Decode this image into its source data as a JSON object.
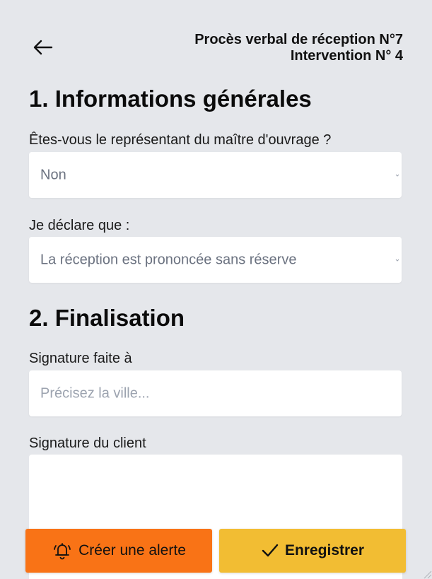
{
  "header": {
    "back_icon": "arrow-left-icon",
    "title_line1": "Procès verbal de réception N°7",
    "title_line2": "Intervention N° 4"
  },
  "section1": {
    "title": "1. Informations générales",
    "question_label": "Êtes-vous le représentant du maître d'ouvrage ?",
    "question_value": "Non",
    "declare_label": "Je déclare que :",
    "declare_value": "La réception est prononcée sans réserve"
  },
  "section2": {
    "title": "2. Finalisation",
    "signature_place_label": "Signature faite à",
    "signature_place_placeholder": "Précisez la ville...",
    "client_signature_label": "Signature du client"
  },
  "actions": {
    "alert_label": "Créer une alerte",
    "alert_icon": "bell-icon",
    "save_label": "Enregistrer",
    "save_icon": "check-icon"
  },
  "colors": {
    "background": "#e5e7eb",
    "alert_button": "#f97316",
    "save_button": "#f2bd33"
  }
}
